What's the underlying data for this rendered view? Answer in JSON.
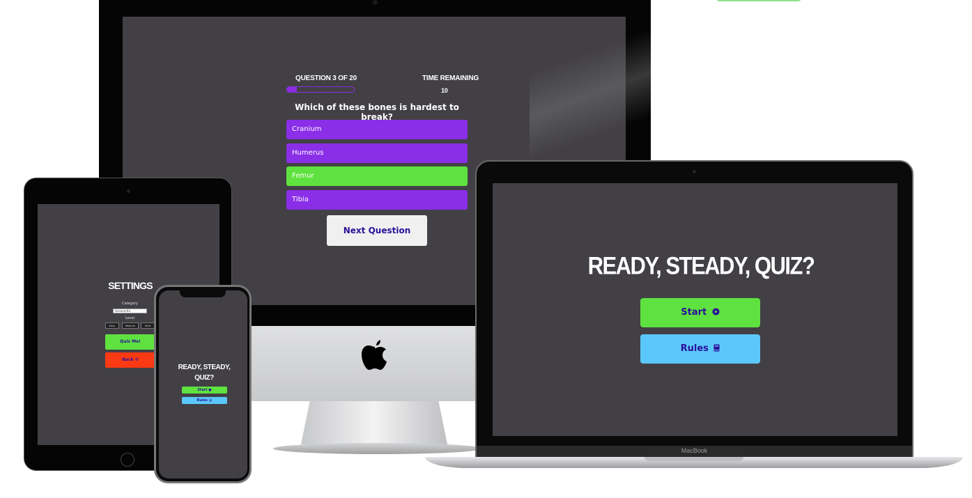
{
  "desktop_quiz": {
    "question_counter": "QUESTION 3 OF 20",
    "time_label": "TIME REMAINING",
    "time_value": "10",
    "progress_fraction": 0.15,
    "question": "Which of these bones is hardest to break?",
    "answers": [
      {
        "label": "Cranium",
        "state": "default"
      },
      {
        "label": "Humerus",
        "state": "default"
      },
      {
        "label": "Femur",
        "state": "correct"
      },
      {
        "label": "Tibia",
        "state": "default"
      }
    ],
    "next_button": "Next Question"
  },
  "laptop_home": {
    "brand": "MacBook",
    "title": "READY, STEADY, QUIZ?",
    "start_button": "Start",
    "start_icon": "play-circle-icon",
    "rules_button": "Rules",
    "rules_icon": "book-icon"
  },
  "tablet_settings": {
    "title": "SETTINGS",
    "category_label": "Category",
    "category_value": "General Kn",
    "difficulty_label": "Level",
    "difficulty_options": [
      "Easy",
      "Medium",
      "Hard"
    ],
    "quiz_button": "Quiz Me!",
    "back_button": "Back ⟲"
  },
  "phone_home": {
    "title_line1": "READY, STEADY,",
    "title_line2": "QUIZ?",
    "start_button": "Start ●",
    "rules_button": "Rules ▤"
  },
  "colors": {
    "screen_bg": "#424045",
    "purple": "#8a2ee8",
    "green": "#5fe23f",
    "blue": "#5bc8fb",
    "red": "#fb3a13",
    "button_text": "#2b0f9a"
  }
}
